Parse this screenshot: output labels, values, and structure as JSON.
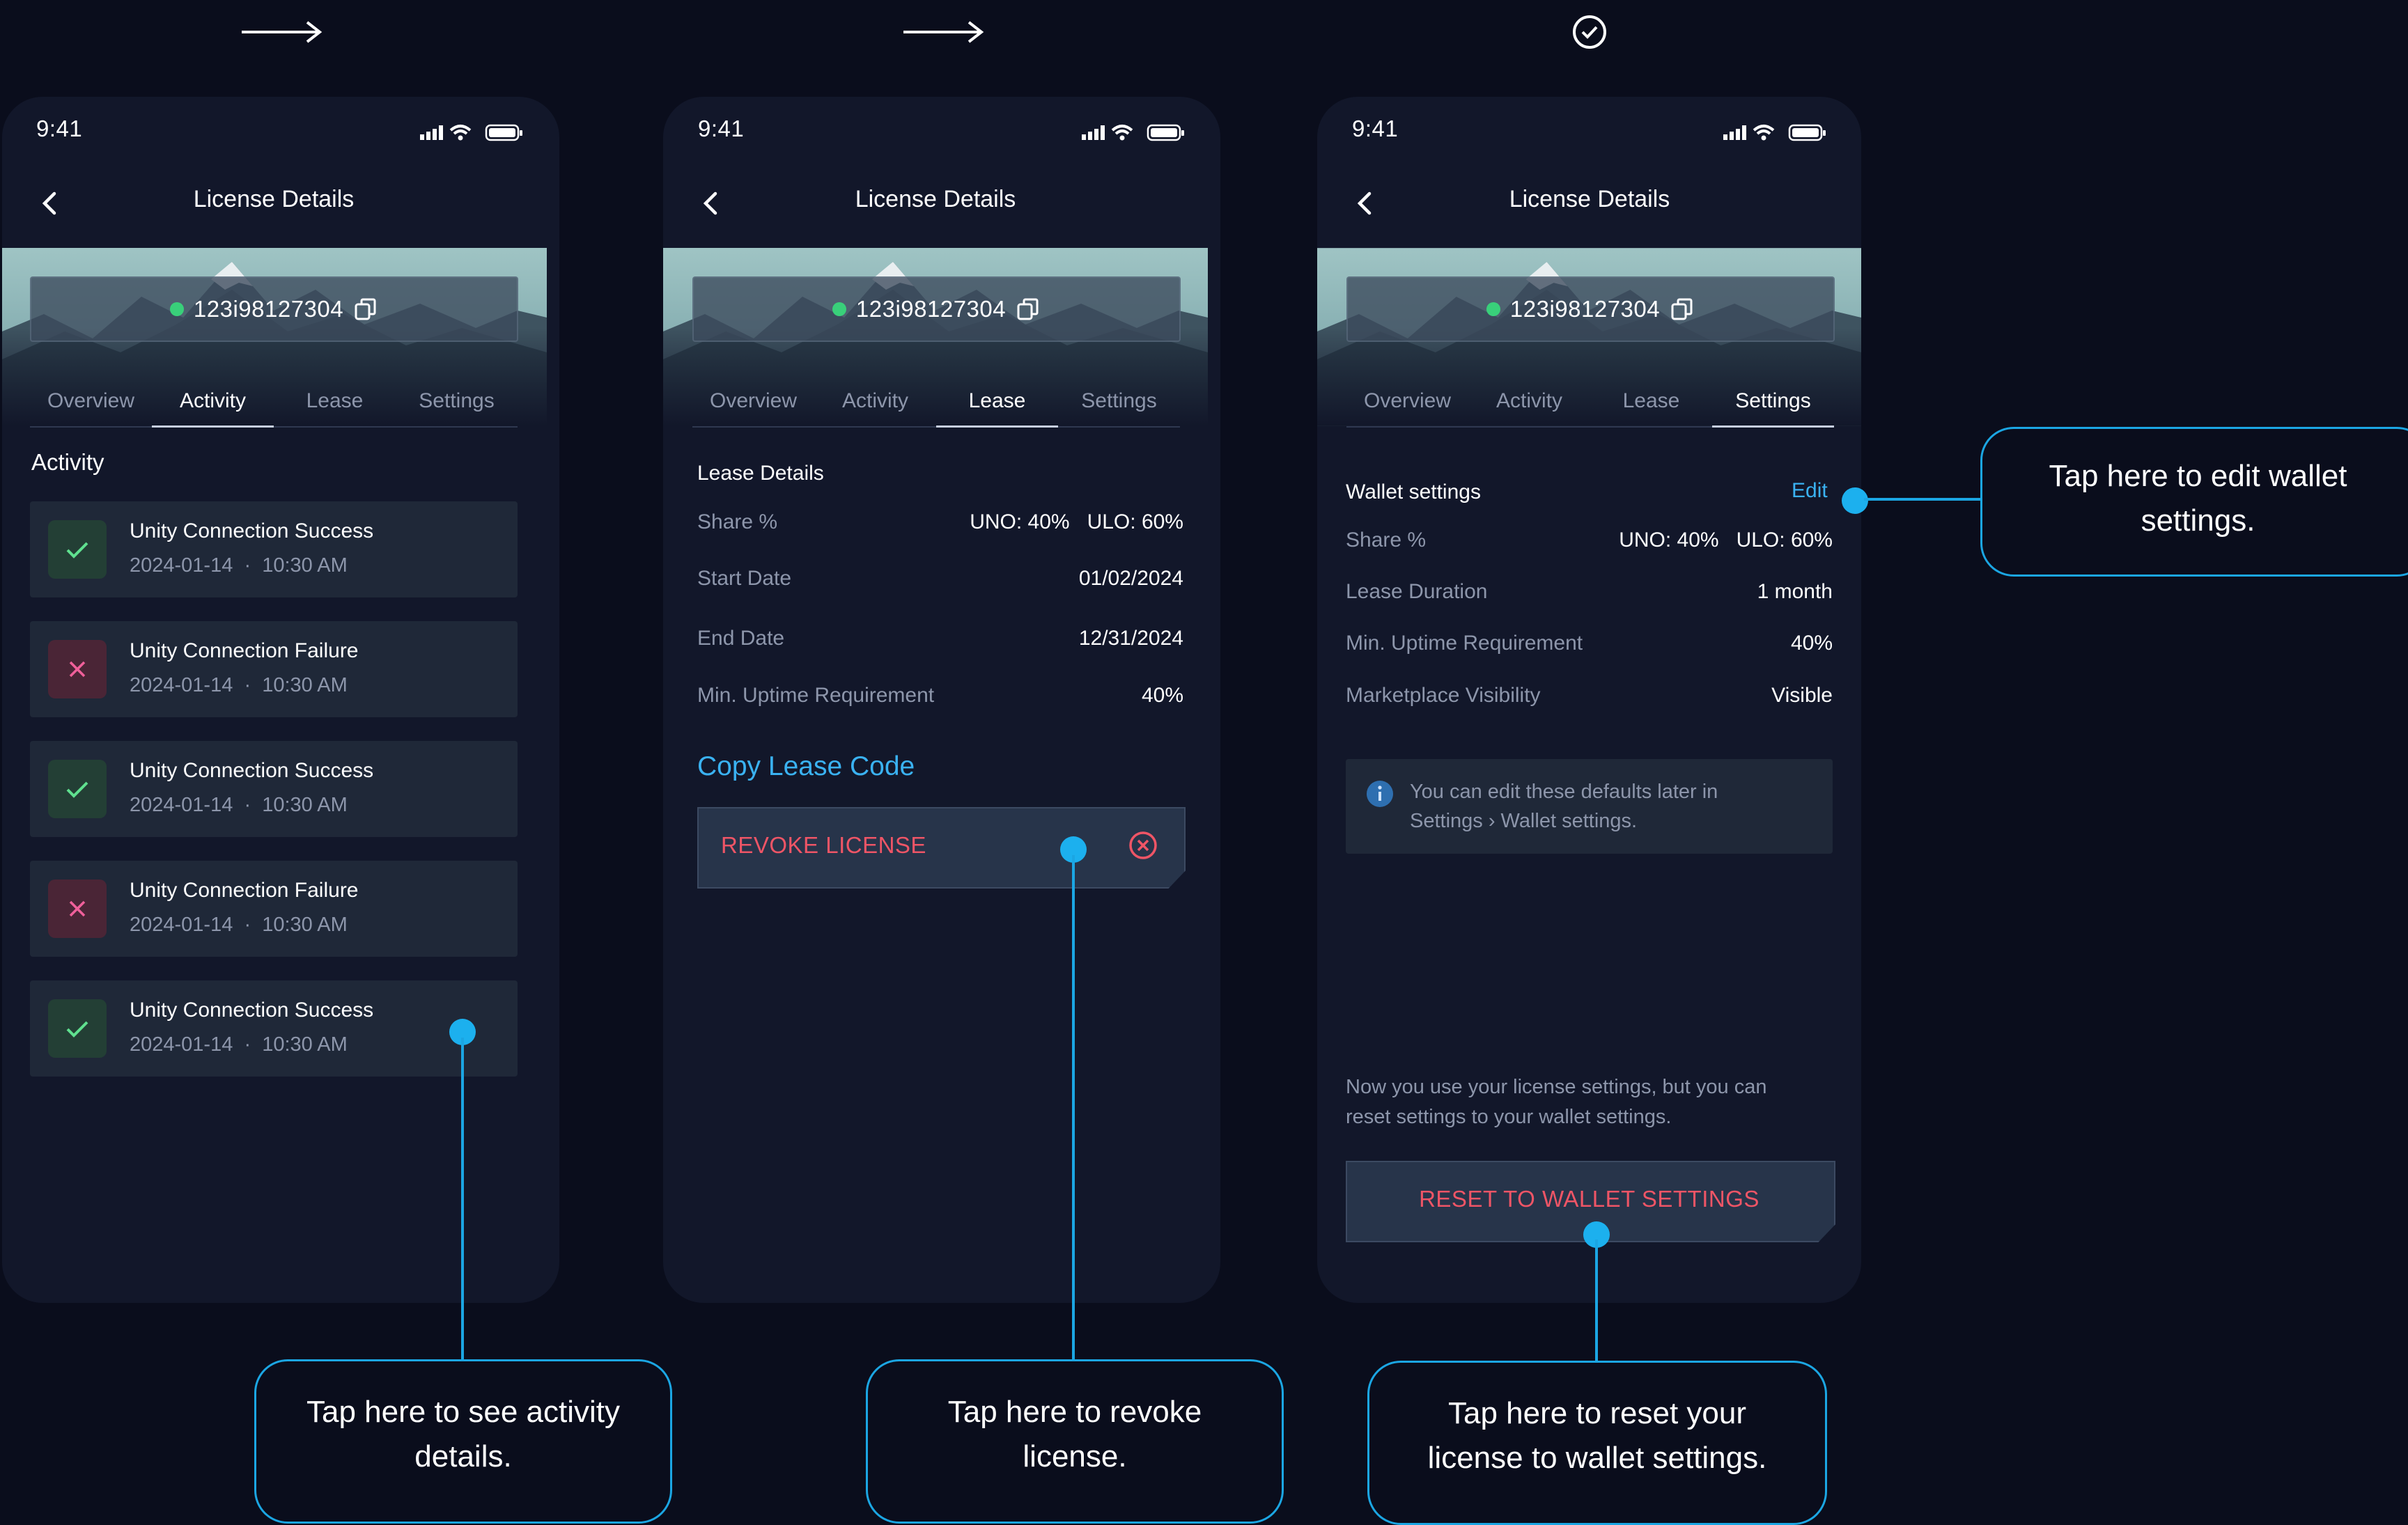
{
  "top_markers": {
    "step1": "arrow-right-icon",
    "step2": "arrow-right-icon",
    "step3": "check-circle-icon"
  },
  "colors": {
    "background": "#0a0d1c",
    "phone": "#12172a",
    "card": "#1f2838",
    "accent": "#1ba6e3",
    "link": "#3ab2f2",
    "danger": "#ef5566",
    "success": "#39d07a"
  },
  "screens": [
    {
      "status": {
        "time": "9:41"
      },
      "header": {
        "title": "License Details"
      },
      "license": {
        "id": "123i98127304"
      },
      "tabs": [
        "Overview",
        "Activity",
        "Lease",
        "Settings"
      ],
      "active_tab": "Activity",
      "activity": {
        "heading": "Activity",
        "items": [
          {
            "title": "Unity Connection Success",
            "date": "2024-01-14",
            "time": "10:30 AM",
            "status": "success"
          },
          {
            "title": "Unity Connection Failure",
            "date": "2024-01-14",
            "time": "10:30 AM",
            "status": "failure"
          },
          {
            "title": "Unity Connection Success",
            "date": "2024-01-14",
            "time": "10:30 AM",
            "status": "success"
          },
          {
            "title": "Unity Connection Failure",
            "date": "2024-01-14",
            "time": "10:30 AM",
            "status": "failure"
          },
          {
            "title": "Unity Connection Success",
            "date": "2024-01-14",
            "time": "10:30 AM",
            "status": "success"
          }
        ]
      }
    },
    {
      "status": {
        "time": "9:41"
      },
      "header": {
        "title": "License Details"
      },
      "license": {
        "id": "123i98127304"
      },
      "tabs": [
        "Overview",
        "Activity",
        "Lease",
        "Settings"
      ],
      "active_tab": "Lease",
      "lease": {
        "heading": "Lease Details",
        "rows": [
          {
            "label": "Share %",
            "value": "UNO: 40%   ULO: 60%"
          },
          {
            "label": "Start Date",
            "value": "01/02/2024"
          },
          {
            "label": "End Date",
            "value": "12/31/2024"
          },
          {
            "label": "Min. Uptime Requirement",
            "value": "40%"
          }
        ],
        "copy_link": "Copy Lease Code",
        "revoke_button": "REVOKE LICENSE"
      }
    },
    {
      "status": {
        "time": "9:41"
      },
      "header": {
        "title": "License Details"
      },
      "license": {
        "id": "123i98127304"
      },
      "tabs": [
        "Overview",
        "Activity",
        "Lease",
        "Settings"
      ],
      "active_tab": "Settings",
      "settings": {
        "heading": "Wallet settings",
        "edit_label": "Edit",
        "rows": [
          {
            "label": "Share %",
            "value": "UNO: 40%   ULO: 60%"
          },
          {
            "label": "Lease Duration",
            "value": "1 month"
          },
          {
            "label": "Min. Uptime Requirement",
            "value": "40%"
          },
          {
            "label": "Marketplace Visibility",
            "value": "Visible"
          }
        ],
        "info_line1": "You can edit these defaults later in",
        "info_line2": "Settings › Wallet settings.",
        "note_line1": "Now you use your license settings, but you can",
        "note_line2": "reset settings to your wallet settings.",
        "reset_button": "RESET TO WALLET SETTINGS"
      }
    }
  ],
  "callouts": {
    "activity_line1": "Tap here to see activity",
    "activity_line2": "details.",
    "revoke_line1": "Tap here to revoke",
    "revoke_line2": "license.",
    "reset_line1": "Tap here to reset your",
    "reset_line2": "license to wallet settings.",
    "edit_line1": "Tap here to edit wallet",
    "edit_line2": "settings."
  }
}
